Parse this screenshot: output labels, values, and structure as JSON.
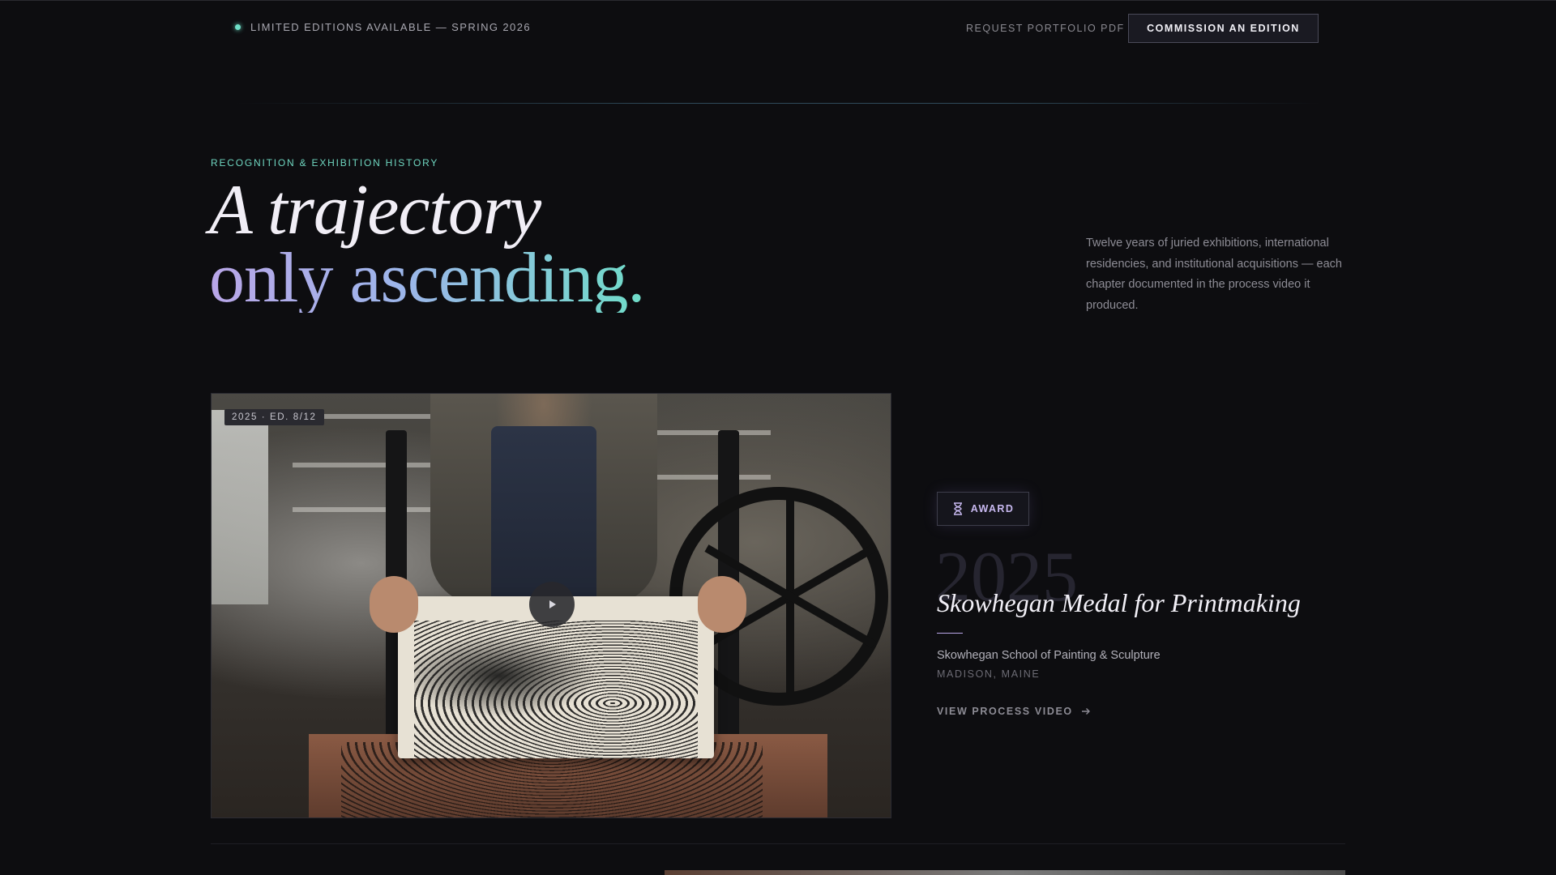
{
  "topbar": {
    "availability": "LIMITED EDITIONS AVAILABLE — SPRING 2026",
    "request_link": "REQUEST PORTFOLIO PDF",
    "commission_button": "COMMISSION AN EDITION"
  },
  "hero": {
    "eyebrow": "RECOGNITION & EXHIBITION HISTORY",
    "title_line1": "A trajectory",
    "title_line2": "only ascending.",
    "intro": "Twelve years of juried exhibitions, international residencies, and institutional acquisitions — each chapter documented in the process video it produced."
  },
  "entry": {
    "badge": "2025 · ED. 8/12",
    "tag": "AWARD",
    "year": "2025",
    "title": "Skowhegan Medal for Printmaking",
    "institution": "Skowhegan School of Painting & Sculpture",
    "location": "MADISON, MAINE",
    "cta": "VIEW PROCESS VIDEO"
  },
  "colors": {
    "accent_teal": "#6fe0c8",
    "accent_lavender": "#b9a6e8",
    "background": "#0d0d10"
  },
  "icons": [
    "status-dot",
    "play-icon",
    "hourglass-icon",
    "arrow-right-icon"
  ]
}
